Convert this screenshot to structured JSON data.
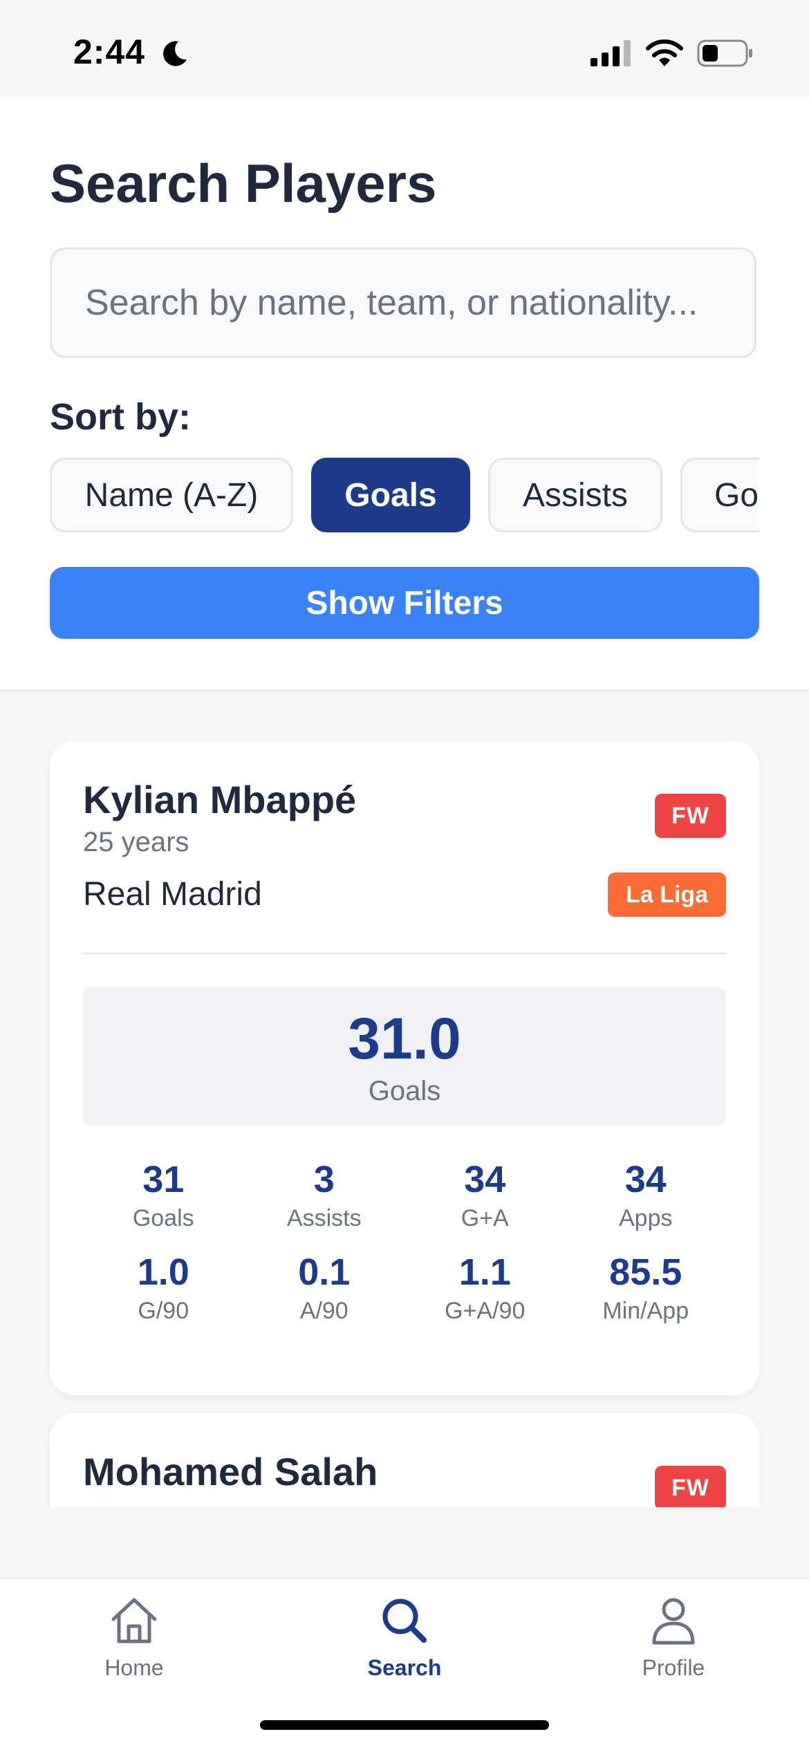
{
  "status_bar": {
    "time": "2:44",
    "icons": [
      "moon-icon",
      "signal-icon",
      "wifi-icon",
      "battery-icon"
    ]
  },
  "header": {
    "title": "Search Players",
    "search_placeholder": "Search by name, team, or nationality...",
    "sort_label": "Sort by:",
    "sort_options": [
      "Name (A-Z)",
      "Goals",
      "Assists",
      "Go"
    ],
    "selected_sort": "Goals",
    "filters_button": "Show Filters"
  },
  "players": [
    {
      "name": "Kylian Mbappé",
      "age": "25 years",
      "team": "Real Madrid",
      "position": "FW",
      "league": "La Liga",
      "highlight": {
        "value": "31.0",
        "label": "Goals"
      },
      "stats": [
        {
          "value": "31",
          "label": "Goals"
        },
        {
          "value": "3",
          "label": "Assists"
        },
        {
          "value": "34",
          "label": "G+A"
        },
        {
          "value": "34",
          "label": "Apps"
        },
        {
          "value": "1.0",
          "label": "G/90"
        },
        {
          "value": "0.1",
          "label": "A/90"
        },
        {
          "value": "1.1",
          "label": "G+A/90"
        },
        {
          "value": "85.5",
          "label": "Min/App"
        }
      ]
    },
    {
      "name": "Mohamed Salah",
      "position": "FW"
    }
  ],
  "tab_bar": {
    "tabs": [
      {
        "label": "Home",
        "icon": "home-icon"
      },
      {
        "label": "Search",
        "icon": "search-icon"
      },
      {
        "label": "Profile",
        "icon": "profile-icon"
      }
    ],
    "active_tab": "Search"
  },
  "colors": {
    "primary_dark": "#1e3a8a",
    "primary_button": "#3b82f6",
    "position_badge": "#ef4444",
    "league_badge": "#ff6b35"
  }
}
